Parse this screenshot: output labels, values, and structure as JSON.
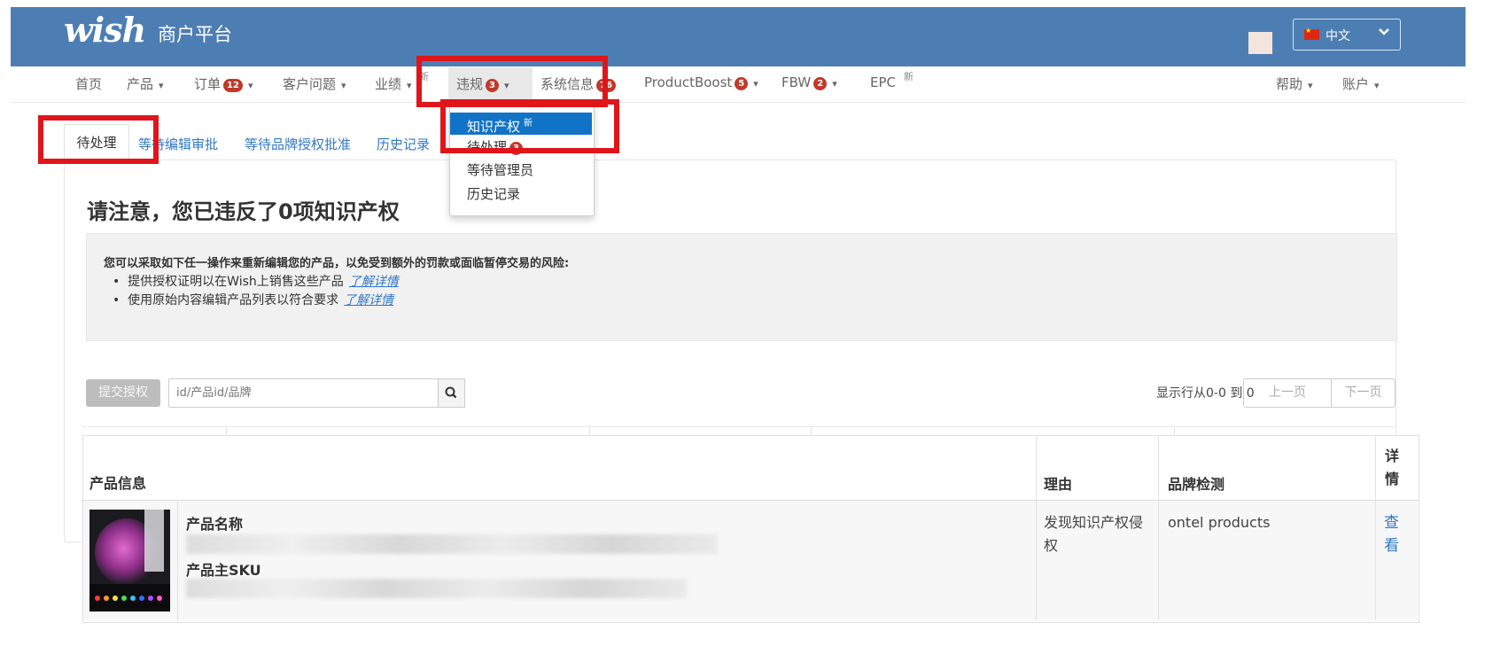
{
  "header": {
    "logo": "wish",
    "platform_name": "商户平台",
    "language": "中文"
  },
  "nav": {
    "home": "首页",
    "products": "产品",
    "orders": "订单",
    "orders_badge": "12",
    "customer_issues": "客户问题",
    "performance": "业绩",
    "performance_tag": "新",
    "violations": "违规",
    "violations_badge": "3",
    "system_info": "系统信息",
    "system_info_badge": "76",
    "product_boost": "ProductBoost",
    "product_boost_badge": "5",
    "fbw": "FBW",
    "fbw_badge": "2",
    "epc": "EPC",
    "epc_tag": "新",
    "help": "帮助",
    "account": "账户"
  },
  "dropdown": {
    "ip": "知识产权",
    "ip_tag": "新",
    "pending": "待处理",
    "pending_badge": "3",
    "awaiting_admin": "等待管理员",
    "history": "历史记录"
  },
  "subtabs": {
    "pending": "待处理",
    "awaiting_edit_review": "等待编辑审批",
    "awaiting_brand_auth": "等待品牌授权批准",
    "history": "历史记录"
  },
  "main": {
    "heading": "请注意，您已违反了0项知识产权",
    "notice_intro": "您可以采取如下任一操作来重新编辑您的产品，以免受到额外的罚款或面临暂停交易的风险:",
    "notice_items": [
      {
        "text": "提供授权证明以在Wish上销售这些产品",
        "link": "了解详情"
      },
      {
        "text": "使用原始内容编辑产品列表以符合要求",
        "link": "了解详情"
      }
    ]
  },
  "toolbar": {
    "submit_auth": "提交授权",
    "search_placeholder": "id/产品id/品牌",
    "rows_info": "显示行从0-0 到 0",
    "prev": "上一页",
    "next": "下一页"
  },
  "table": {
    "headers": {
      "product_info": "产品信息",
      "reason": "理由",
      "brand_detection": "品牌检测",
      "details": "详情"
    },
    "rows": [
      {
        "name_label": "产品名称",
        "sku_label": "产品主SKU",
        "reason": "发现知识产权侵权",
        "brand": "ontel products",
        "view": "查看"
      }
    ]
  }
}
